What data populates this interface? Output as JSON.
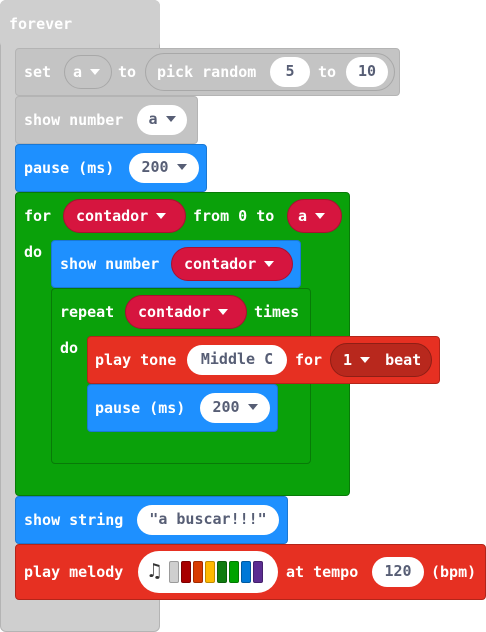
{
  "forever": {
    "label": "forever"
  },
  "set_block": {
    "label": "set",
    "variable": "a",
    "to_label": "to",
    "random": {
      "label": "pick random",
      "from": "5",
      "to_label": "to",
      "to": "10"
    }
  },
  "show_number_a": {
    "label": "show number",
    "value": "a"
  },
  "pause_1": {
    "label": "pause (ms)",
    "value": "200"
  },
  "for_block": {
    "label": "for",
    "variable": "contador",
    "from_label": "from 0 to",
    "to": "a",
    "do_label": "do"
  },
  "show_number_c": {
    "label": "show number",
    "value": "contador"
  },
  "repeat_block": {
    "label": "repeat",
    "count": "contador",
    "times_label": "times",
    "do_label": "do"
  },
  "play_tone": {
    "label": "play tone",
    "note": "Middle C",
    "for_label": "for",
    "beat": "1",
    "beat_label": "beat"
  },
  "pause_2": {
    "label": "pause (ms)",
    "value": "200"
  },
  "show_string": {
    "label": "show string",
    "value": "\"a buscar!!!\""
  },
  "play_melody": {
    "label": "play melody",
    "tempo_label": "at tempo",
    "tempo": "120",
    "unit": "(bpm)",
    "icon": "music-note-icon",
    "colors": [
      "#cfcfcf",
      "#a80000",
      "#d83b01",
      "#ffb900",
      "#107c10",
      "#00a300",
      "#0078d7",
      "#5c2d91"
    ]
  }
}
